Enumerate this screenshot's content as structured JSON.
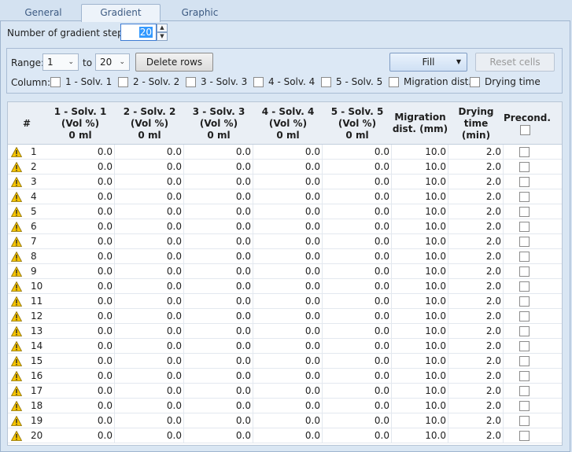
{
  "tabs": [
    {
      "label": "General",
      "active": false
    },
    {
      "label": "Gradient",
      "active": true
    },
    {
      "label": "Graphic",
      "active": false
    }
  ],
  "steps": {
    "label": "Number of gradient steps:",
    "value": "20"
  },
  "range": {
    "label": "Range:",
    "from": "1",
    "to_label": "to",
    "to": "20",
    "delete_label": "Delete rows",
    "fill_label": "Fill",
    "reset_label": "Reset cells"
  },
  "column_options": {
    "label": "Column:",
    "items": [
      "1 - Solv. 1",
      "2 - Solv. 2",
      "3 - Solv. 3",
      "4 - Solv. 4",
      "5 - Solv. 5",
      "Migration dist.",
      "Drying time"
    ]
  },
  "table": {
    "headers": [
      {
        "label": "#"
      },
      {
        "label": "1 - Solv. 1\n(Vol %)\n0 ml"
      },
      {
        "label": "2 - Solv. 2\n(Vol %)\n0 ml"
      },
      {
        "label": "3 - Solv. 3\n(Vol %)\n0 ml"
      },
      {
        "label": "4 - Solv. 4\n(Vol %)\n0 ml"
      },
      {
        "label": "5 - Solv. 5\n(Vol %)\n0 ml"
      },
      {
        "label": "Migration\ndist. (mm)"
      },
      {
        "label": "Drying\ntime (min)"
      },
      {
        "label": "Precond."
      }
    ],
    "rows": [
      {
        "n": "1",
        "s1": "0.0",
        "s2": "0.0",
        "s3": "0.0",
        "s4": "0.0",
        "s5": "0.0",
        "mig": "10.0",
        "dry": "2.0"
      },
      {
        "n": "2",
        "s1": "0.0",
        "s2": "0.0",
        "s3": "0.0",
        "s4": "0.0",
        "s5": "0.0",
        "mig": "10.0",
        "dry": "2.0"
      },
      {
        "n": "3",
        "s1": "0.0",
        "s2": "0.0",
        "s3": "0.0",
        "s4": "0.0",
        "s5": "0.0",
        "mig": "10.0",
        "dry": "2.0"
      },
      {
        "n": "4",
        "s1": "0.0",
        "s2": "0.0",
        "s3": "0.0",
        "s4": "0.0",
        "s5": "0.0",
        "mig": "10.0",
        "dry": "2.0"
      },
      {
        "n": "5",
        "s1": "0.0",
        "s2": "0.0",
        "s3": "0.0",
        "s4": "0.0",
        "s5": "0.0",
        "mig": "10.0",
        "dry": "2.0"
      },
      {
        "n": "6",
        "s1": "0.0",
        "s2": "0.0",
        "s3": "0.0",
        "s4": "0.0",
        "s5": "0.0",
        "mig": "10.0",
        "dry": "2.0"
      },
      {
        "n": "7",
        "s1": "0.0",
        "s2": "0.0",
        "s3": "0.0",
        "s4": "0.0",
        "s5": "0.0",
        "mig": "10.0",
        "dry": "2.0"
      },
      {
        "n": "8",
        "s1": "0.0",
        "s2": "0.0",
        "s3": "0.0",
        "s4": "0.0",
        "s5": "0.0",
        "mig": "10.0",
        "dry": "2.0"
      },
      {
        "n": "9",
        "s1": "0.0",
        "s2": "0.0",
        "s3": "0.0",
        "s4": "0.0",
        "s5": "0.0",
        "mig": "10.0",
        "dry": "2.0"
      },
      {
        "n": "10",
        "s1": "0.0",
        "s2": "0.0",
        "s3": "0.0",
        "s4": "0.0",
        "s5": "0.0",
        "mig": "10.0",
        "dry": "2.0"
      },
      {
        "n": "11",
        "s1": "0.0",
        "s2": "0.0",
        "s3": "0.0",
        "s4": "0.0",
        "s5": "0.0",
        "mig": "10.0",
        "dry": "2.0"
      },
      {
        "n": "12",
        "s1": "0.0",
        "s2": "0.0",
        "s3": "0.0",
        "s4": "0.0",
        "s5": "0.0",
        "mig": "10.0",
        "dry": "2.0"
      },
      {
        "n": "13",
        "s1": "0.0",
        "s2": "0.0",
        "s3": "0.0",
        "s4": "0.0",
        "s5": "0.0",
        "mig": "10.0",
        "dry": "2.0"
      },
      {
        "n": "14",
        "s1": "0.0",
        "s2": "0.0",
        "s3": "0.0",
        "s4": "0.0",
        "s5": "0.0",
        "mig": "10.0",
        "dry": "2.0"
      },
      {
        "n": "15",
        "s1": "0.0",
        "s2": "0.0",
        "s3": "0.0",
        "s4": "0.0",
        "s5": "0.0",
        "mig": "10.0",
        "dry": "2.0"
      },
      {
        "n": "16",
        "s1": "0.0",
        "s2": "0.0",
        "s3": "0.0",
        "s4": "0.0",
        "s5": "0.0",
        "mig": "10.0",
        "dry": "2.0"
      },
      {
        "n": "17",
        "s1": "0.0",
        "s2": "0.0",
        "s3": "0.0",
        "s4": "0.0",
        "s5": "0.0",
        "mig": "10.0",
        "dry": "2.0"
      },
      {
        "n": "18",
        "s1": "0.0",
        "s2": "0.0",
        "s3": "0.0",
        "s4": "0.0",
        "s5": "0.0",
        "mig": "10.0",
        "dry": "2.0"
      },
      {
        "n": "19",
        "s1": "0.0",
        "s2": "0.0",
        "s3": "0.0",
        "s4": "0.0",
        "s5": "0.0",
        "mig": "10.0",
        "dry": "2.0"
      },
      {
        "n": "20",
        "s1": "0.0",
        "s2": "0.0",
        "s3": "0.0",
        "s4": "0.0",
        "s5": "0.0",
        "mig": "10.0",
        "dry": "2.0"
      }
    ],
    "row_icon": "warning-icon"
  },
  "colors": {
    "accent": "#3399ff",
    "warning": "#f5c400",
    "panel": "#d9e6f3"
  }
}
